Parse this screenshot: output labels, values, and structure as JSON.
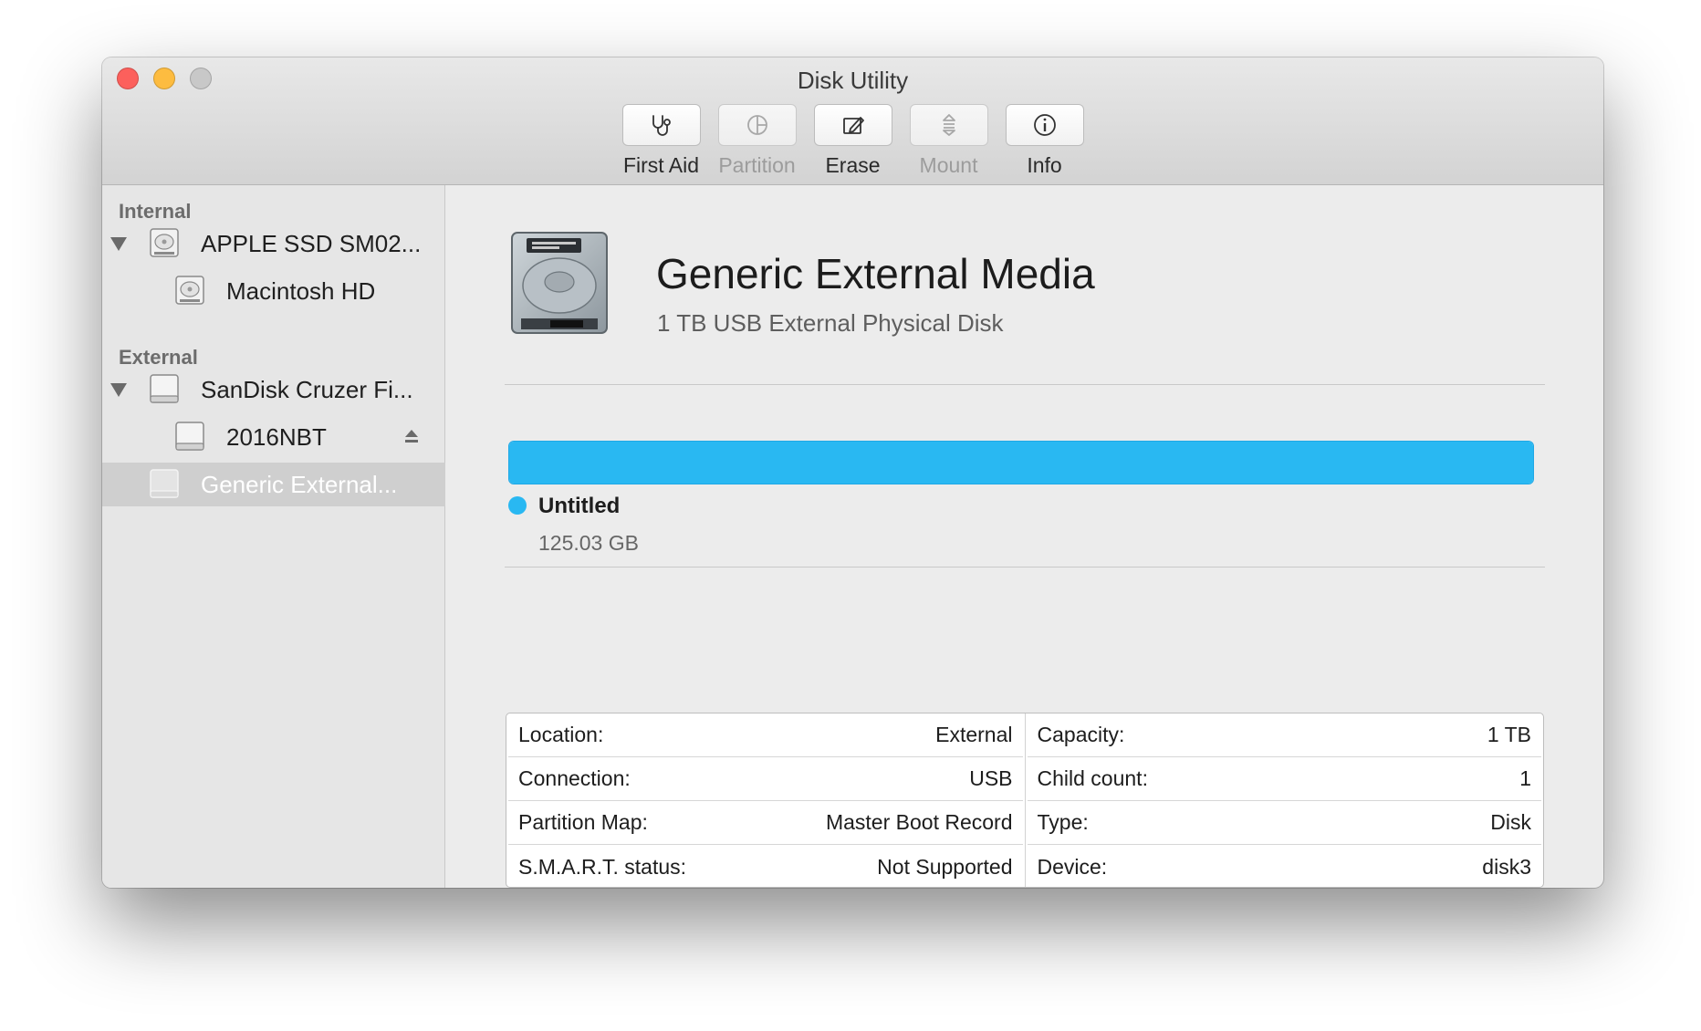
{
  "window": {
    "title": "Disk Utility"
  },
  "toolbar": {
    "first_aid": "First Aid",
    "partition": "Partition",
    "erase": "Erase",
    "mount": "Mount",
    "info": "Info"
  },
  "sidebar": {
    "internal_header": "Internal",
    "external_header": "External",
    "items": [
      {
        "label": "APPLE SSD SM02...",
        "icon": "internal-disk-icon"
      },
      {
        "label": "Macintosh HD",
        "icon": "internal-volume-icon"
      },
      {
        "label": "SanDisk Cruzer Fi...",
        "icon": "external-disk-icon"
      },
      {
        "label": "2016NBT",
        "icon": "external-volume-icon"
      },
      {
        "label": "Generic External...",
        "icon": "external-disk-icon"
      }
    ]
  },
  "main": {
    "disk_name": "Generic External Media",
    "disk_desc": "1 TB USB External Physical Disk",
    "usage_fill_fraction": 1.0,
    "volume_name": "Untitled",
    "volume_size": "125.03 GB",
    "info_left": [
      {
        "label": "Location:",
        "value": "External"
      },
      {
        "label": "Connection:",
        "value": "USB"
      },
      {
        "label": "Partition Map:",
        "value": "Master Boot Record"
      },
      {
        "label": "S.M.A.R.T. status:",
        "value": "Not Supported"
      }
    ],
    "info_right": [
      {
        "label": "Capacity:",
        "value": "1 TB"
      },
      {
        "label": "Child count:",
        "value": "1"
      },
      {
        "label": "Type:",
        "value": "Disk"
      },
      {
        "label": "Device:",
        "value": "disk3"
      }
    ]
  },
  "colors": {
    "accent": "#29b8f2",
    "close": "#fc605c",
    "minimize": "#fdbc40"
  }
}
